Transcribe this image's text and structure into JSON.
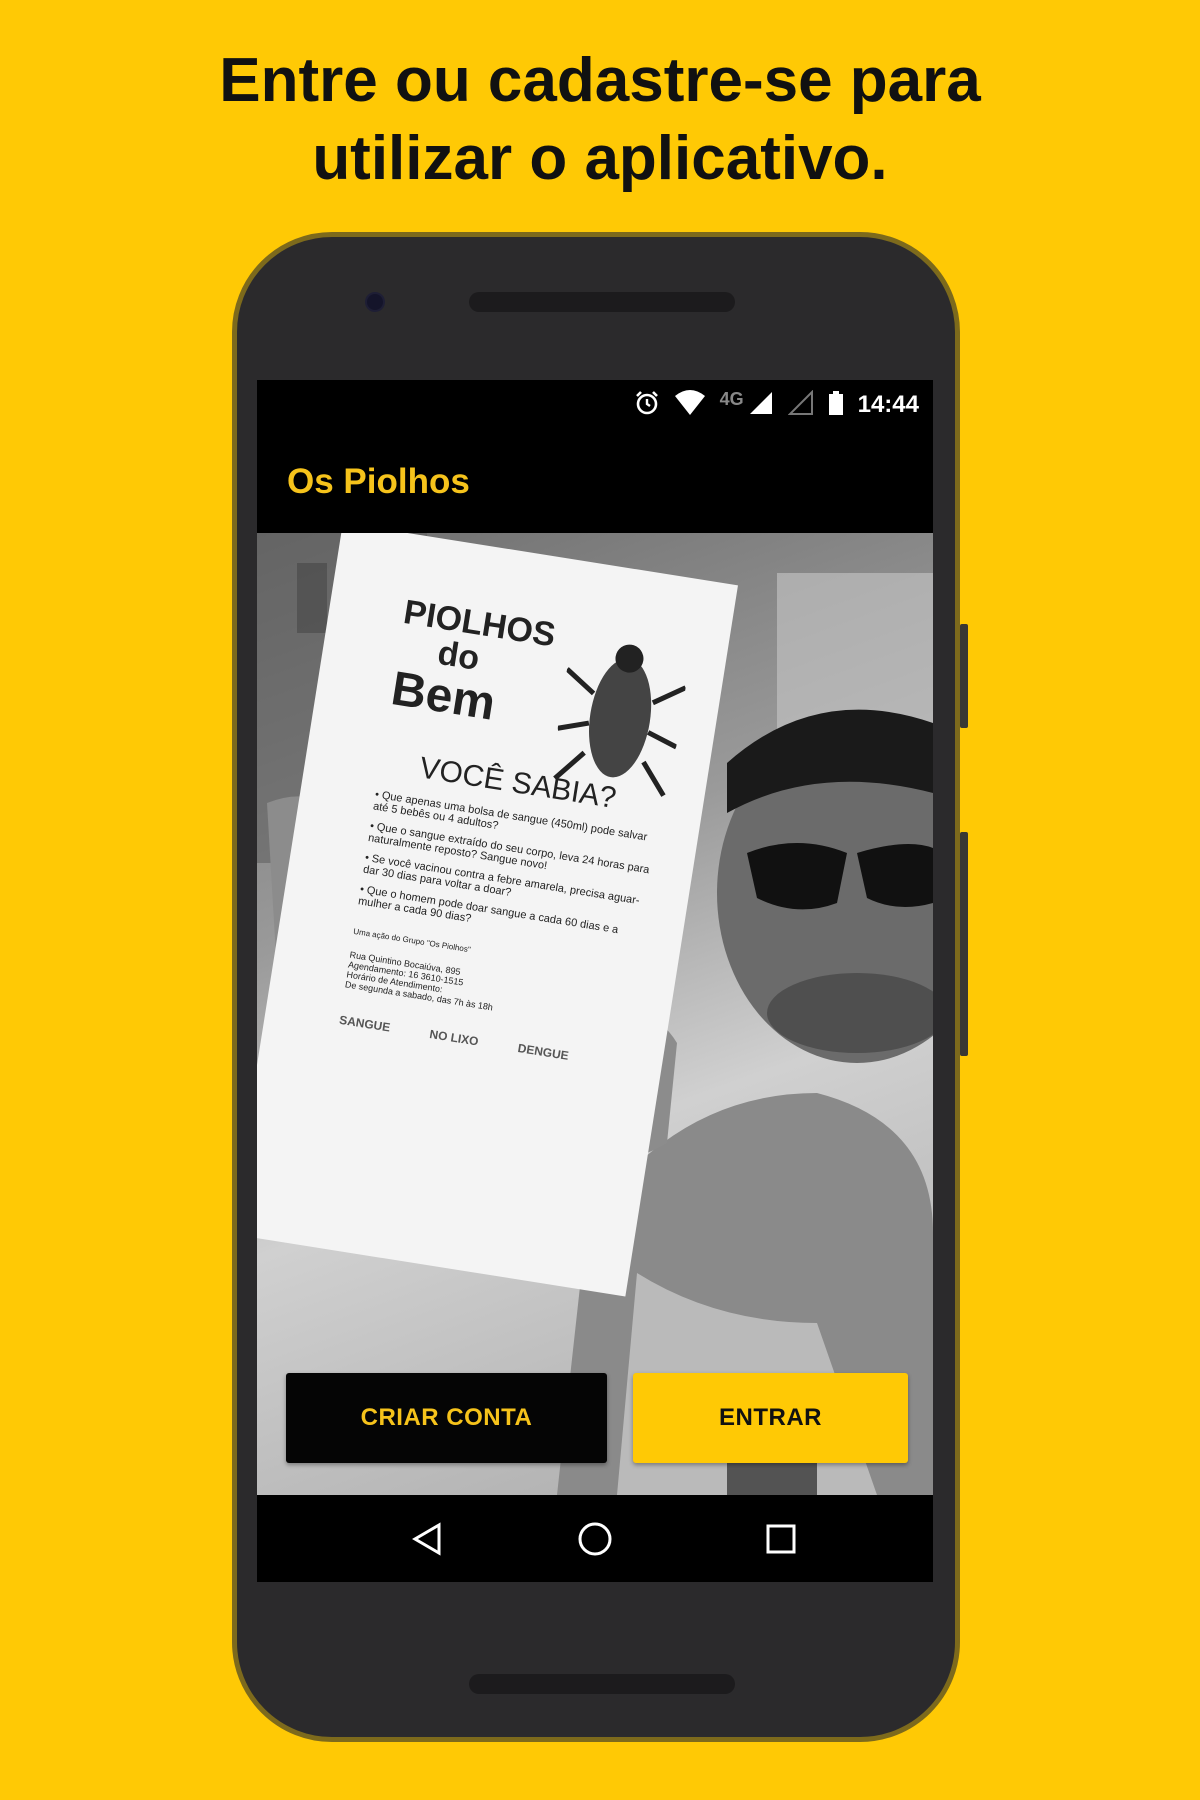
{
  "headline": {
    "line1": "Entre ou cadastre-se para",
    "line2": "utilizar o aplicativo."
  },
  "status_bar": {
    "network": "4G",
    "time": "14:44",
    "icons": [
      "alarm-icon",
      "wifi-icon",
      "signal-icon",
      "signal-empty-icon",
      "battery-icon"
    ]
  },
  "app_bar": {
    "title": "Os Piolhos"
  },
  "hero": {
    "flyer": {
      "brand_line1": "PIOLHOS",
      "brand_line2": "do",
      "brand_line3": "Bem",
      "heading": "VOCÊ SABIA?",
      "bullets": [
        "• Que apenas uma bolsa de sangue (450ml) pode salvar",
        "até 5 bebês ou 4 adultos?",
        "• Que o sangue extraído do seu corpo, leva 24 horas para",
        "naturalmente reposto? Sangue novo!",
        "• Se você vacinou contra a febre amarela, precisa aguar-",
        "dar 30 dias para voltar a doar?",
        "• Que o homem pode doar sangue a cada 60 dias e a",
        "mulher a cada 90 dias?"
      ],
      "credit": "Uma ação do Grupo \"Os Piolhos\"",
      "address": [
        "Rua Quintino Bocaiúva, 895",
        "Agendamento: 16 3610-1515",
        "Horário de Atendimento:",
        "De segunda a sabado, das 7h às 18h"
      ],
      "logos": [
        "SANGUE",
        "NO LIXO",
        "DENGUE"
      ]
    }
  },
  "buttons": {
    "create_account": "CRIAR CONTA",
    "login": "ENTRAR"
  },
  "nav": {
    "icons": [
      "back-icon",
      "home-icon",
      "recent-apps-icon"
    ]
  },
  "colors": {
    "background": "#FFC905",
    "accent": "#F6C31B",
    "phone_body": "#2b2a2c"
  }
}
